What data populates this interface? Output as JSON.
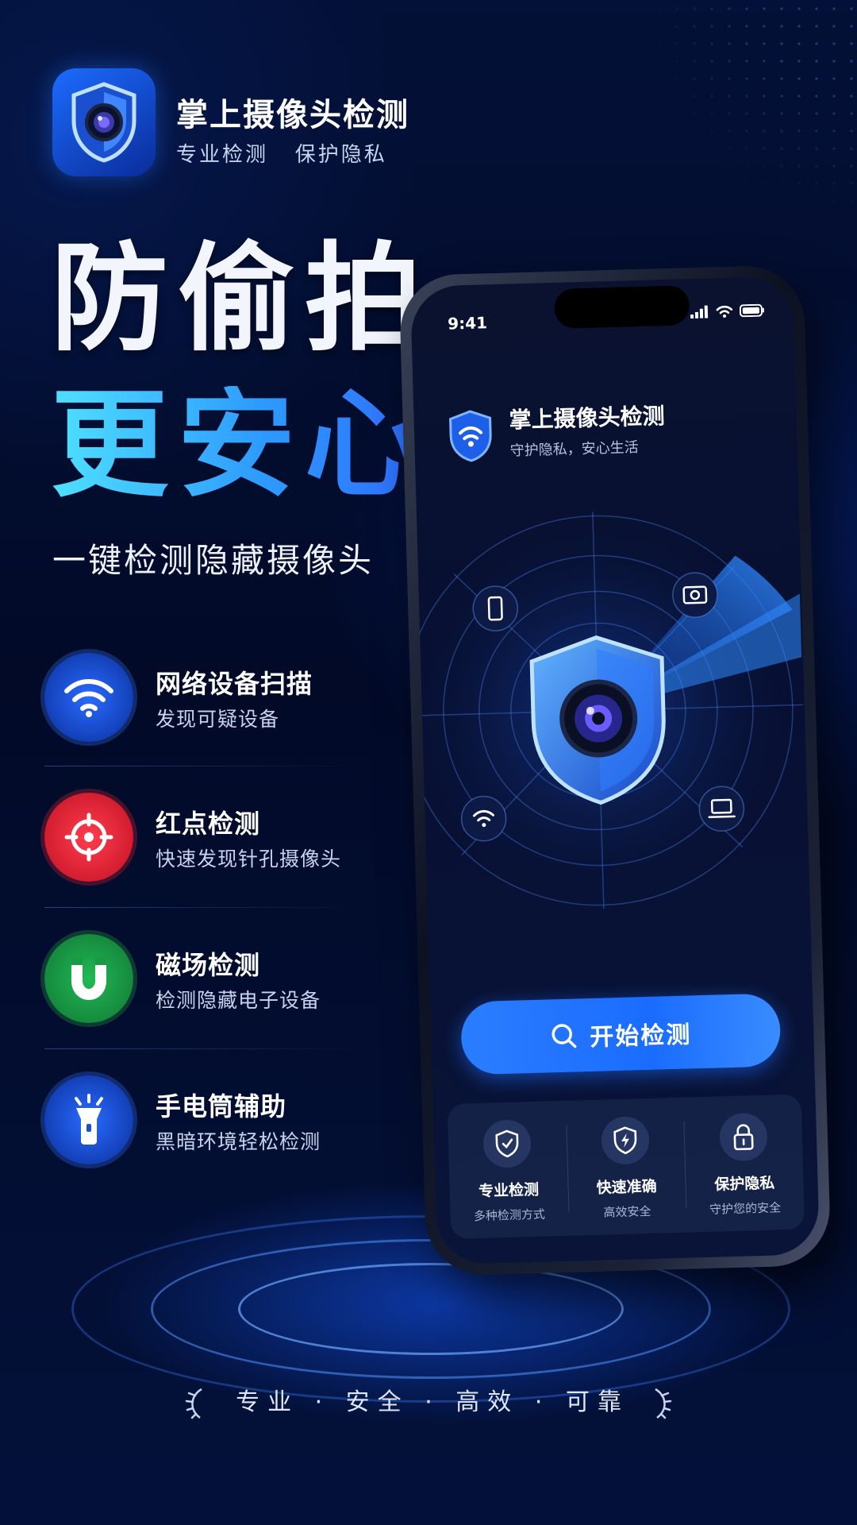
{
  "header": {
    "app_name": "掌上摄像头检测",
    "app_subtitle": "专业检测   保护隐私"
  },
  "hero": {
    "line1": "防偷拍",
    "line2": "更安心",
    "subtitle": "一键检测隐藏摄像头"
  },
  "features": [
    {
      "title": "网络设备扫描",
      "desc": "发现可疑设备",
      "icon": "wifi-icon",
      "color": "#1f5fe0"
    },
    {
      "title": "红点检测",
      "desc": "快速发现针孔摄像头",
      "icon": "target-icon",
      "color": "#e3263a"
    },
    {
      "title": "磁场检测",
      "desc": "检测隐藏电子设备",
      "icon": "magnet-icon",
      "color": "#1aa14a"
    },
    {
      "title": "手电筒辅助",
      "desc": "黑暗环境轻松检测",
      "icon": "flashlight-icon",
      "color": "#1f5fe0"
    }
  ],
  "phone": {
    "status_time": "9:41",
    "app_title": "掌上摄像头检测",
    "app_subtitle": "守护隐私，安心生活",
    "start_button": "开始检测",
    "bottom_items": [
      {
        "title": "专业检测",
        "desc": "多种检测方式",
        "icon": "shield-icon"
      },
      {
        "title": "快速准确",
        "desc": "高效安全",
        "icon": "lightning-icon"
      },
      {
        "title": "保护隐私",
        "desc": "守护您的安全",
        "icon": "lock-icon"
      }
    ]
  },
  "footer": {
    "tagline": "专业 · 安全 · 高效 · 可靠"
  },
  "colors": {
    "background": "#020b2a",
    "accent": "#2b7dff",
    "hero_gradient_start": "#4fe0ff"
  }
}
